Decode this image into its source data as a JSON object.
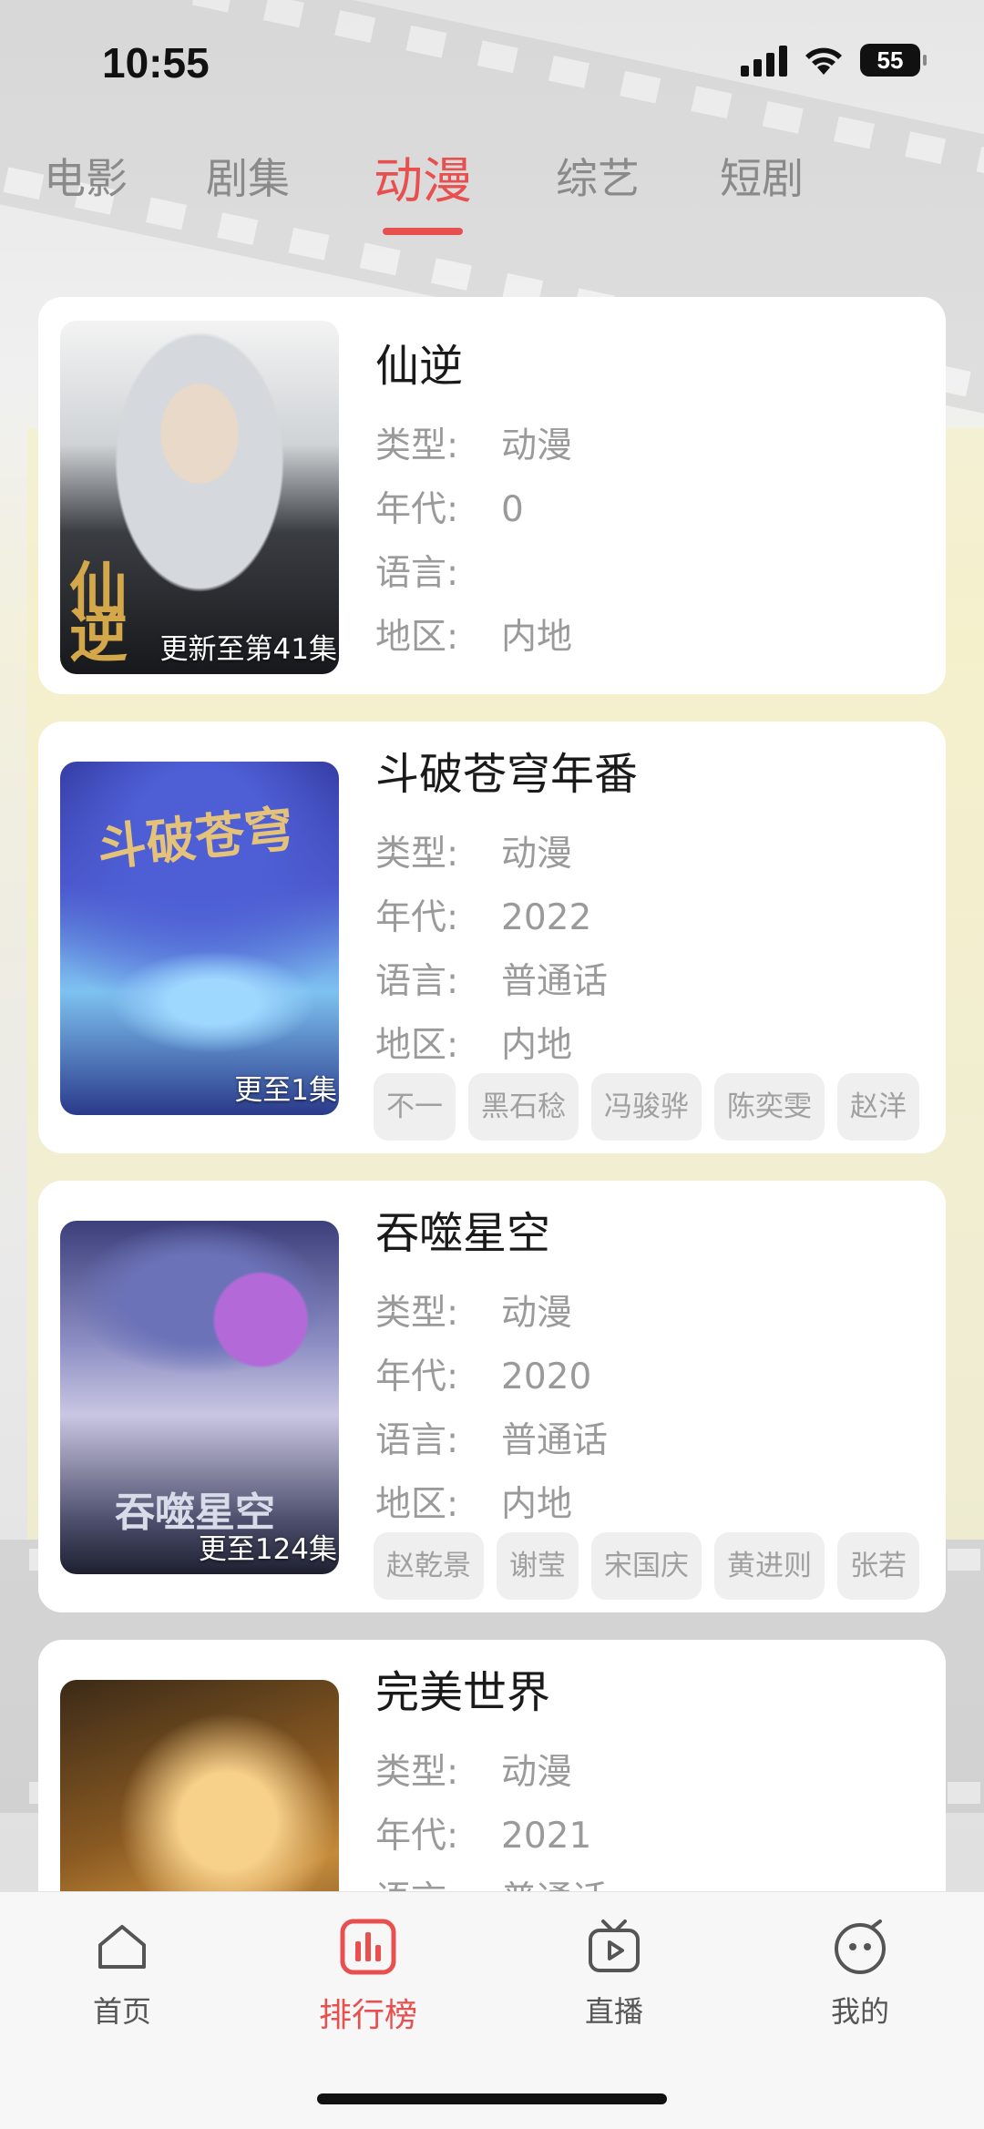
{
  "status_bar": {
    "time": "10:55",
    "battery": "55"
  },
  "tabs": [
    {
      "label": "电影",
      "active": false
    },
    {
      "label": "剧集",
      "active": false
    },
    {
      "label": "动漫",
      "active": true
    },
    {
      "label": "综艺",
      "active": false
    },
    {
      "label": "短剧",
      "active": false
    }
  ],
  "field_labels": {
    "genre": "类型:",
    "year": "年代:",
    "language": "语言:",
    "region": "地区:"
  },
  "items": [
    {
      "title": "仙逆",
      "genre": "动漫",
      "year": "0",
      "language": "",
      "region": "内地",
      "badge": "更新至第41集",
      "cast": []
    },
    {
      "title": "斗破苍穹年番",
      "genre": "动漫",
      "year": "2022",
      "language": "普通话",
      "region": "内地",
      "badge": "更至1集",
      "cast": [
        "不一",
        "黑石稔",
        "冯骏骅",
        "陈奕雯",
        "赵洋"
      ]
    },
    {
      "title": "吞噬星空",
      "genre": "动漫",
      "year": "2020",
      "language": "普通话",
      "region": "内地",
      "badge": "更至124集",
      "cast": [
        "赵乾景",
        "谢莹",
        "宋国庆",
        "黄进则",
        "张若"
      ]
    },
    {
      "title": "完美世界",
      "genre": "动漫",
      "year": "2021",
      "language": "普通话",
      "region": "",
      "badge": "",
      "cast": []
    }
  ],
  "poster_art_text": {
    "xianni": "仙逆",
    "doupo": "斗破苍穹",
    "tunshi": "吞噬星空"
  },
  "tabbar": {
    "home": "首页",
    "ranking": "排行榜",
    "live": "直播",
    "mine": "我的"
  },
  "colors": {
    "accent": "#e8504f",
    "chip_bg": "#efefef",
    "muted_text": "#9a9a9a"
  }
}
